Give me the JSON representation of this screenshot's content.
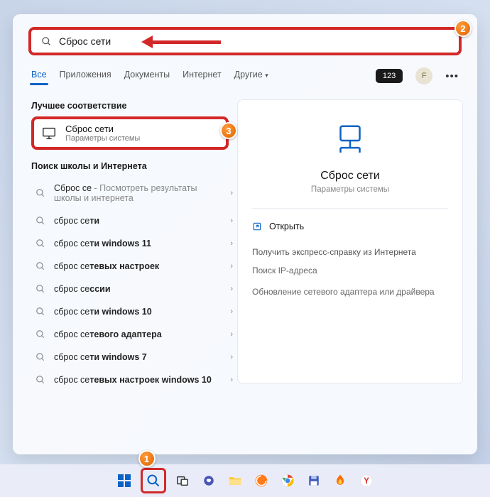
{
  "search": {
    "value": "Сброс сети"
  },
  "tabs": [
    "Все",
    "Приложения",
    "Документы",
    "Интернет",
    "Другие"
  ],
  "pill": "123",
  "avatar": "F",
  "sections": {
    "best": "Лучшее соответствие",
    "web": "Поиск школы и Интернета"
  },
  "best": {
    "title": "Сброс сети",
    "subtitle": "Параметры системы"
  },
  "webHint": {
    "prefix": "Сброс се",
    "suffix": " - Посмотреть результаты школы и интернета"
  },
  "suggestions": [
    {
      "pre": "сброс се",
      "post": "ти"
    },
    {
      "pre": "сброс се",
      "post": "ти windows 11"
    },
    {
      "pre": "сброс се",
      "post": "тевых настроек"
    },
    {
      "pre": "сброс се",
      "post": "ссии"
    },
    {
      "pre": "сброс се",
      "post": "ти windows 10"
    },
    {
      "pre": "сброс се",
      "post": "тевого адаптера"
    },
    {
      "pre": "сброс се",
      "post": "ти windows 7"
    },
    {
      "pre": "сброс се",
      "post": "тевых настроек windows 10"
    }
  ],
  "detail": {
    "title": "Сброс сети",
    "subtitle": "Параметры системы",
    "open": "Открыть",
    "helpHeader": "Получить экспресс-справку из Интернета",
    "helpItems": [
      "Поиск IP-адреса",
      "Обновление сетевого адаптера или драйвера"
    ]
  },
  "badges": {
    "b1": "1",
    "b2": "2",
    "b3": "3"
  }
}
